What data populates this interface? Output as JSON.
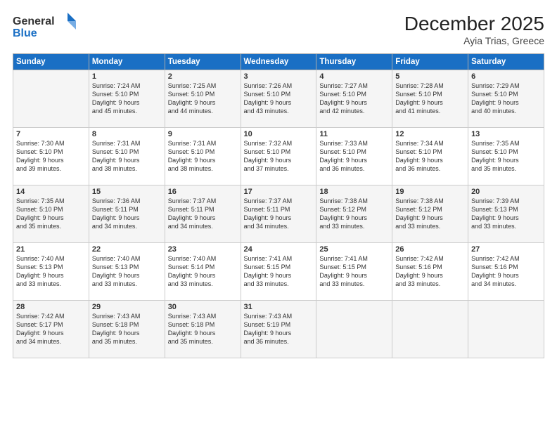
{
  "header": {
    "logo_line1": "General",
    "logo_line2": "Blue",
    "month": "December 2025",
    "location": "Ayia Trias, Greece"
  },
  "weekdays": [
    "Sunday",
    "Monday",
    "Tuesday",
    "Wednesday",
    "Thursday",
    "Friday",
    "Saturday"
  ],
  "weeks": [
    [
      {
        "day": "",
        "text": ""
      },
      {
        "day": "1",
        "text": "Sunrise: 7:24 AM\nSunset: 5:10 PM\nDaylight: 9 hours\nand 45 minutes."
      },
      {
        "day": "2",
        "text": "Sunrise: 7:25 AM\nSunset: 5:10 PM\nDaylight: 9 hours\nand 44 minutes."
      },
      {
        "day": "3",
        "text": "Sunrise: 7:26 AM\nSunset: 5:10 PM\nDaylight: 9 hours\nand 43 minutes."
      },
      {
        "day": "4",
        "text": "Sunrise: 7:27 AM\nSunset: 5:10 PM\nDaylight: 9 hours\nand 42 minutes."
      },
      {
        "day": "5",
        "text": "Sunrise: 7:28 AM\nSunset: 5:10 PM\nDaylight: 9 hours\nand 41 minutes."
      },
      {
        "day": "6",
        "text": "Sunrise: 7:29 AM\nSunset: 5:10 PM\nDaylight: 9 hours\nand 40 minutes."
      }
    ],
    [
      {
        "day": "7",
        "text": "Sunrise: 7:30 AM\nSunset: 5:10 PM\nDaylight: 9 hours\nand 39 minutes."
      },
      {
        "day": "8",
        "text": "Sunrise: 7:31 AM\nSunset: 5:10 PM\nDaylight: 9 hours\nand 38 minutes."
      },
      {
        "day": "9",
        "text": "Sunrise: 7:31 AM\nSunset: 5:10 PM\nDaylight: 9 hours\nand 38 minutes."
      },
      {
        "day": "10",
        "text": "Sunrise: 7:32 AM\nSunset: 5:10 PM\nDaylight: 9 hours\nand 37 minutes."
      },
      {
        "day": "11",
        "text": "Sunrise: 7:33 AM\nSunset: 5:10 PM\nDaylight: 9 hours\nand 36 minutes."
      },
      {
        "day": "12",
        "text": "Sunrise: 7:34 AM\nSunset: 5:10 PM\nDaylight: 9 hours\nand 36 minutes."
      },
      {
        "day": "13",
        "text": "Sunrise: 7:35 AM\nSunset: 5:10 PM\nDaylight: 9 hours\nand 35 minutes."
      }
    ],
    [
      {
        "day": "14",
        "text": "Sunrise: 7:35 AM\nSunset: 5:10 PM\nDaylight: 9 hours\nand 35 minutes."
      },
      {
        "day": "15",
        "text": "Sunrise: 7:36 AM\nSunset: 5:11 PM\nDaylight: 9 hours\nand 34 minutes."
      },
      {
        "day": "16",
        "text": "Sunrise: 7:37 AM\nSunset: 5:11 PM\nDaylight: 9 hours\nand 34 minutes."
      },
      {
        "day": "17",
        "text": "Sunrise: 7:37 AM\nSunset: 5:11 PM\nDaylight: 9 hours\nand 34 minutes."
      },
      {
        "day": "18",
        "text": "Sunrise: 7:38 AM\nSunset: 5:12 PM\nDaylight: 9 hours\nand 33 minutes."
      },
      {
        "day": "19",
        "text": "Sunrise: 7:38 AM\nSunset: 5:12 PM\nDaylight: 9 hours\nand 33 minutes."
      },
      {
        "day": "20",
        "text": "Sunrise: 7:39 AM\nSunset: 5:13 PM\nDaylight: 9 hours\nand 33 minutes."
      }
    ],
    [
      {
        "day": "21",
        "text": "Sunrise: 7:40 AM\nSunset: 5:13 PM\nDaylight: 9 hours\nand 33 minutes."
      },
      {
        "day": "22",
        "text": "Sunrise: 7:40 AM\nSunset: 5:13 PM\nDaylight: 9 hours\nand 33 minutes."
      },
      {
        "day": "23",
        "text": "Sunrise: 7:40 AM\nSunset: 5:14 PM\nDaylight: 9 hours\nand 33 minutes."
      },
      {
        "day": "24",
        "text": "Sunrise: 7:41 AM\nSunset: 5:15 PM\nDaylight: 9 hours\nand 33 minutes."
      },
      {
        "day": "25",
        "text": "Sunrise: 7:41 AM\nSunset: 5:15 PM\nDaylight: 9 hours\nand 33 minutes."
      },
      {
        "day": "26",
        "text": "Sunrise: 7:42 AM\nSunset: 5:16 PM\nDaylight: 9 hours\nand 33 minutes."
      },
      {
        "day": "27",
        "text": "Sunrise: 7:42 AM\nSunset: 5:16 PM\nDaylight: 9 hours\nand 34 minutes."
      }
    ],
    [
      {
        "day": "28",
        "text": "Sunrise: 7:42 AM\nSunset: 5:17 PM\nDaylight: 9 hours\nand 34 minutes."
      },
      {
        "day": "29",
        "text": "Sunrise: 7:43 AM\nSunset: 5:18 PM\nDaylight: 9 hours\nand 35 minutes."
      },
      {
        "day": "30",
        "text": "Sunrise: 7:43 AM\nSunset: 5:18 PM\nDaylight: 9 hours\nand 35 minutes."
      },
      {
        "day": "31",
        "text": "Sunrise: 7:43 AM\nSunset: 5:19 PM\nDaylight: 9 hours\nand 36 minutes."
      },
      {
        "day": "",
        "text": ""
      },
      {
        "day": "",
        "text": ""
      },
      {
        "day": "",
        "text": ""
      }
    ]
  ]
}
